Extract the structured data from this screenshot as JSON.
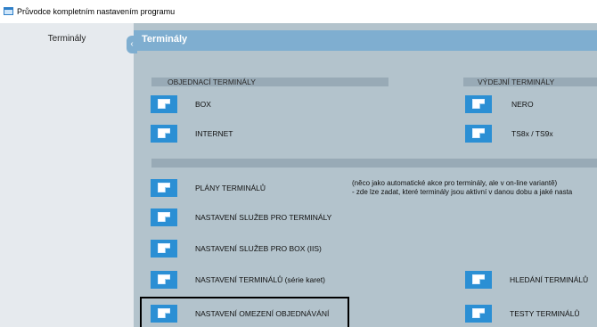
{
  "window": {
    "title": "Průvodce kompletním nastavením programu",
    "icon": "window-icon"
  },
  "sidebar": {
    "items": [
      {
        "label": "Terminály"
      }
    ]
  },
  "panel": {
    "title": "Terminály",
    "collapse_glyph": "‹"
  },
  "sections": {
    "objednaci": {
      "title": "OBJEDNACÍ  TERMINÁLY"
    },
    "vydejni": {
      "title": "VÝDEJNÍ  TERMINÁLY"
    }
  },
  "buttons": {
    "box": "BOX",
    "internet": "INTERNET",
    "nero": "NERO",
    "ts8x": "TS8x / TS9x",
    "plany": "PLÁNY  TERMINÁLŮ",
    "sluzby_terminaly": "NASTAVENÍ  SLUŽEB PRO TERMINÁLY",
    "sluzby_box": "NASTAVENÍ  SLUŽEB PRO BOX (IIS)",
    "nastaveni_terminalu": "NASTAVENÍ  TERMINÁLŮ  (série karet)",
    "hledani": "HLEDÁNÍ  TERMINÁLŮ",
    "omezeni": "NASTAVENÍ  OMEZENÍ  OBJEDNÁVÁNÍ",
    "testy": "TESTY  TERMINÁLŮ"
  },
  "notes": {
    "plany_line1": "(něco jako automatické akce pro terminály, ale v on-line variantě)",
    "plany_line2": "- zde lze zadat, které terminály jsou aktivní v danou dobu a jaké nasta"
  },
  "colors": {
    "header": "#7faed0",
    "panel_bg": "#b3c3cc",
    "button": "#2b8fd4"
  }
}
